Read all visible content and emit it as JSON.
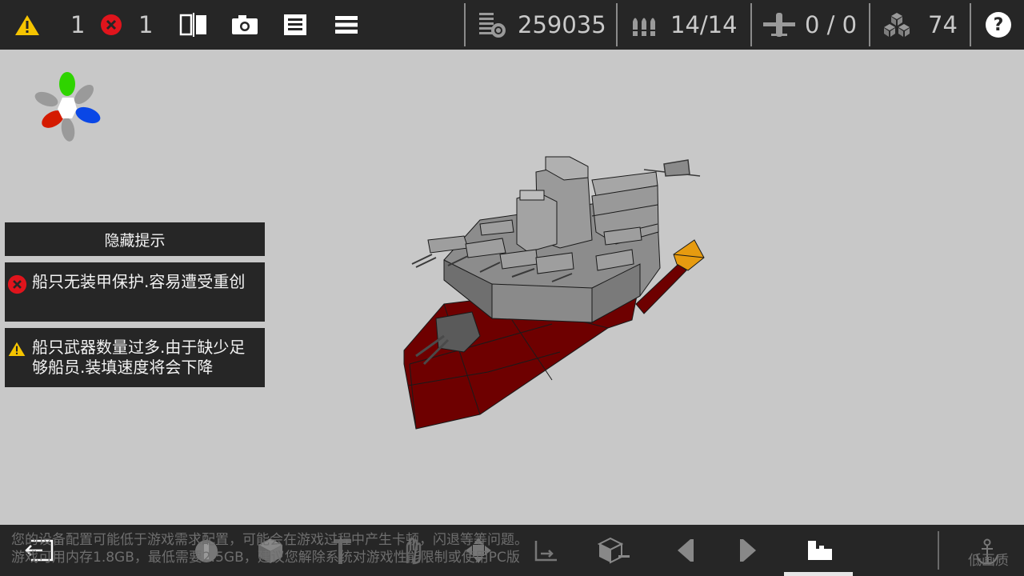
{
  "topbar": {
    "warning_count": "1",
    "error_count": "1",
    "money": "259035",
    "weapons": "14/14",
    "aircraft": "0 / 0",
    "parts": "74",
    "help_label": "?"
  },
  "hints": {
    "hide_label": "隐藏提示",
    "error_msg": "船只无装甲保护.容易遭受重创",
    "warning_msg": "船只武器数量过多.由于缺少足够船员.装填速度将会下降"
  },
  "bottom": {
    "notice_line1": "您的设备配置可能低于游戏需求配置，可能会在游戏过程中产生卡顿，闪退等等问题。",
    "notice_line2": "游戏可用内存1.8GB，最低需要2.5GB，建议您解除系统对游戏性能限制或使用PC版",
    "quality_label": "低画质"
  },
  "colors": {
    "bar": "#262626",
    "background": "#c8c8c8",
    "hull_red": "#6e0000",
    "deck_gray": "#8c8c8c",
    "warning_yellow": "#f5c400",
    "error_red": "#e0141c",
    "gizmo_green": "#2fd400",
    "gizmo_blue": "#0a47e6",
    "gizmo_red": "#d41a00"
  },
  "icons": [
    "warning-icon",
    "error-icon",
    "mirror-icon",
    "camera-icon",
    "save-icon",
    "menu-icon",
    "money-icon",
    "ammo-icon",
    "plane-icon",
    "parts-icon",
    "help-icon",
    "exit-icon",
    "anchor-icon"
  ]
}
